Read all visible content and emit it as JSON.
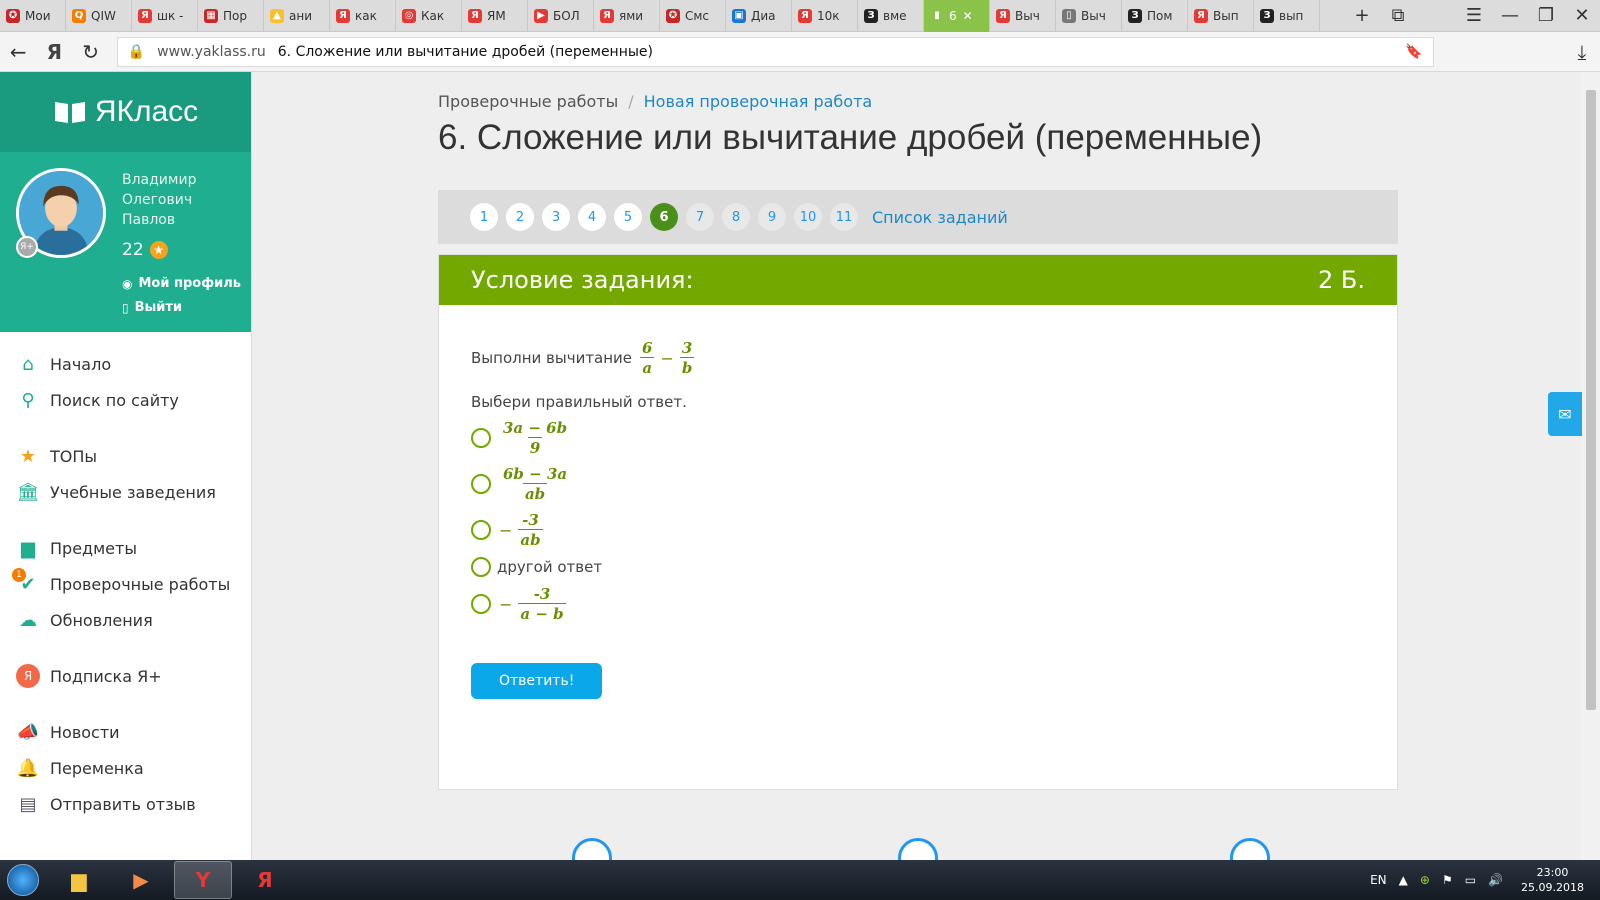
{
  "browser": {
    "tabs": [
      {
        "label": "Мои",
        "color": "#c62828",
        "glyph": "✪"
      },
      {
        "label": "QIW",
        "color": "#f57c00",
        "glyph": "Q"
      },
      {
        "label": "шк -",
        "color": "#e53935",
        "glyph": "Я"
      },
      {
        "label": "Пор",
        "color": "#c62828",
        "glyph": "▦"
      },
      {
        "label": "ани",
        "color": "#fbc02d",
        "glyph": "▲"
      },
      {
        "label": "как",
        "color": "#e53935",
        "glyph": "Я"
      },
      {
        "label": "Как",
        "color": "#e53935",
        "glyph": "◎"
      },
      {
        "label": "ЯМ",
        "color": "#e53935",
        "glyph": "Я"
      },
      {
        "label": "БОЛ",
        "color": "#e53935",
        "glyph": "▶"
      },
      {
        "label": "ями",
        "color": "#e53935",
        "glyph": "Я"
      },
      {
        "label": "Смс",
        "color": "#c62828",
        "glyph": "✪"
      },
      {
        "label": "Диа",
        "color": "#1976d2",
        "glyph": "▣"
      },
      {
        "label": "10к",
        "color": "#e53935",
        "glyph": "Я"
      },
      {
        "label": "вме",
        "color": "#222222",
        "glyph": "З"
      },
      {
        "label": "6",
        "color": "#8bc34a",
        "glyph": "▮",
        "active": true
      },
      {
        "label": "Выч",
        "color": "#e53935",
        "glyph": "Я"
      },
      {
        "label": "Выч",
        "color": "#777777",
        "glyph": "▯"
      },
      {
        "label": "Пом",
        "color": "#222222",
        "glyph": "З"
      },
      {
        "label": "Вып",
        "color": "#e53935",
        "glyph": "Я"
      },
      {
        "label": "вып",
        "color": "#222222",
        "glyph": "З"
      }
    ],
    "host": "www.yaklass.ru",
    "page_title": "6. Сложение или вычитание дробей (переменные)"
  },
  "sidebar": {
    "logo": "ЯКласс",
    "user": {
      "name_line1": "Владимир",
      "name_line2": "Олегович",
      "name_line3": "Павлов",
      "points": "22",
      "profile_link": "Мой профиль",
      "logout_link": "Выйти"
    },
    "menu": [
      {
        "label": "Начало",
        "icon": "home-icon",
        "glyph": "⌂"
      },
      {
        "label": "Поиск по сайту",
        "icon": "search-icon",
        "glyph": "⚲"
      },
      {
        "label": "ТОПы",
        "icon": "star-icon",
        "glyph": "★",
        "gap_before": true
      },
      {
        "label": "Учебные заведения",
        "icon": "institution-icon",
        "glyph": "🏛"
      },
      {
        "label": "Предметы",
        "icon": "book-icon",
        "glyph": "▆",
        "gap_before": true
      },
      {
        "label": "Проверочные работы",
        "icon": "check-icon",
        "glyph": "✔",
        "badge": "1"
      },
      {
        "label": "Обновления",
        "icon": "cloud-icon",
        "glyph": "☁"
      },
      {
        "label": "Подписка Я+",
        "icon": "subscription-icon",
        "glyph": "Я",
        "gap_before": true
      },
      {
        "label": "Новости",
        "icon": "megaphone-icon",
        "glyph": "📣",
        "gap_before": true
      },
      {
        "label": "Переменка",
        "icon": "bell-icon",
        "glyph": "🔔"
      },
      {
        "label": "Отправить отзыв",
        "icon": "feedback-icon",
        "glyph": "▤"
      }
    ]
  },
  "main": {
    "breadcrumb_root": "Проверочные работы",
    "breadcrumb_current": "Новая проверочная работа",
    "title": "6. Сложение или вычитание дробей (переменные)",
    "pages": [
      "1",
      "2",
      "3",
      "4",
      "5",
      "6",
      "7",
      "8",
      "9",
      "10",
      "11"
    ],
    "active_page": "6",
    "task_list_link": "Список заданий",
    "task_header": "Условие задания:",
    "task_points": "2 Б.",
    "question_text": "Выполни вычитание",
    "question_frac1_num": "6",
    "question_frac1_den": "a",
    "question_op": "−",
    "question_frac2_num": "3",
    "question_frac2_den": "b",
    "hint": "Выбери правильный ответ.",
    "options": [
      {
        "num": "3a − 6b",
        "den": "9"
      },
      {
        "num": "6b − 3a",
        "den": "ab"
      },
      {
        "prefix": "−",
        "num": "-3",
        "den": "ab"
      },
      {
        "text": "другой ответ"
      },
      {
        "prefix": "−",
        "num": "-3",
        "den": "a − b"
      }
    ],
    "submit_label": "Ответить!"
  },
  "taskbar": {
    "lang": "EN",
    "time": "23:00",
    "date": "25.09.2018"
  },
  "colors": {
    "brand_green": "#1fae8f",
    "task_header": "#72a800",
    "link_blue": "#1e88c7",
    "submit_blue": "#0aa8e8"
  }
}
